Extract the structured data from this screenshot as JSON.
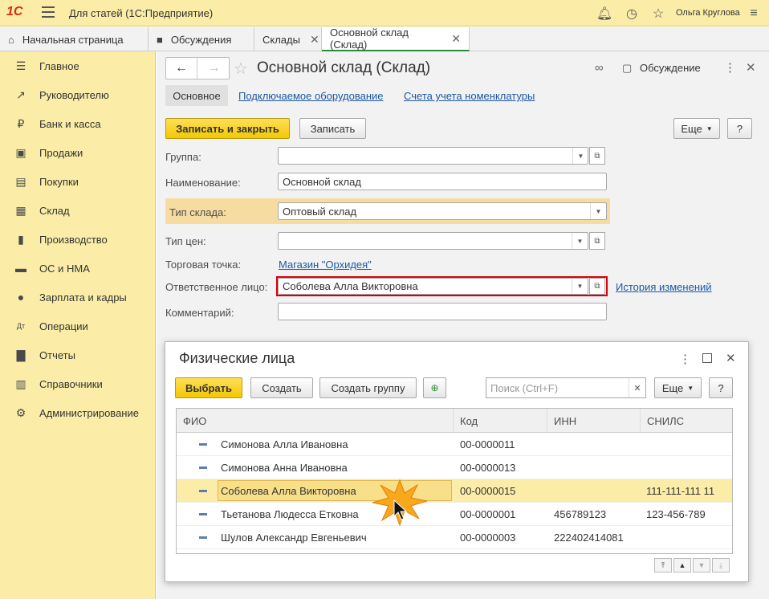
{
  "titlebar": {
    "logo": "1С",
    "title": "Для статей  (1С:Предприятие)",
    "user": "Ольга Круглова"
  },
  "tabs": [
    {
      "label": "Начальная страница"
    },
    {
      "label": "Обсуждения"
    },
    {
      "label": "Склады"
    },
    {
      "label": "Основной склад (Склад)"
    }
  ],
  "sidebar": {
    "items": [
      {
        "label": "Главное",
        "icon": "menu-lines-icon"
      },
      {
        "label": "Руководителю",
        "icon": "trend-chart-icon"
      },
      {
        "label": "Банк и касса",
        "icon": "ruble-coin-icon"
      },
      {
        "label": "Продажи",
        "icon": "shopping-bag-icon"
      },
      {
        "label": "Покупки",
        "icon": "shopping-cart-icon"
      },
      {
        "label": "Склад",
        "icon": "warehouse-grid-icon"
      },
      {
        "label": "Производство",
        "icon": "factory-icon"
      },
      {
        "label": "ОС и НМА",
        "icon": "truck-icon"
      },
      {
        "label": "Зарплата и кадры",
        "icon": "person-icon"
      },
      {
        "label": "Операции",
        "icon": "dt-kt-icon"
      },
      {
        "label": "Отчеты",
        "icon": "bar-chart-icon"
      },
      {
        "label": "Справочники",
        "icon": "books-icon"
      },
      {
        "label": "Администрирование",
        "icon": "gear-icon"
      }
    ]
  },
  "form": {
    "title": "Основной склад (Склад)",
    "discussion": "Обсуждение",
    "subtabs": [
      "Основное",
      "Подключаемое оборудование",
      "Счета учета номенклатуры"
    ],
    "save_close": "Записать и закрыть",
    "save": "Записать",
    "more": "Еще",
    "help": "?",
    "fields": {
      "group": {
        "label": "Группа:",
        "value": ""
      },
      "name": {
        "label": "Наименование:",
        "value": "Основной склад"
      },
      "type": {
        "label": "Тип склада:",
        "value": "Оптовый склад"
      },
      "price_type": {
        "label": "Тип цен:",
        "value": ""
      },
      "store": {
        "label": "Торговая точка:",
        "value": "Магазин \"Орхидея\""
      },
      "responsible": {
        "label": "Ответственное лицо:",
        "value": "Соболева Алла Викторовна"
      },
      "comment": {
        "label": "Комментарий:",
        "value": ""
      }
    },
    "history_link": "История изменений"
  },
  "dialog": {
    "title": "Физические лица",
    "select": "Выбрать",
    "create": "Создать",
    "create_group": "Создать группу",
    "search_placeholder": "Поиск (Ctrl+F)",
    "more": "Еще",
    "help": "?",
    "columns": [
      "ФИО",
      "Код",
      "ИНН",
      "СНИЛС"
    ],
    "rows": [
      {
        "name": "Симонова Алла Ивановна",
        "code": "00-0000011",
        "inn": "",
        "snils": ""
      },
      {
        "name": "Симонова Анна Ивановна",
        "code": "00-0000013",
        "inn": "",
        "snils": ""
      },
      {
        "name": "Соболева Алла Викторовна",
        "code": "00-0000015",
        "inn": "",
        "snils": "111-111-111 11"
      },
      {
        "name": "Тьетанова Людесса Етковна",
        "code": "00-0000001",
        "inn": "456789123",
        "snils": "123-456-789"
      },
      {
        "name": "Шулов Александр Евгеньевич",
        "code": "00-0000003",
        "inn": "222402414081",
        "snils": ""
      }
    ],
    "selected_row": 2
  },
  "colors": {
    "accent_yellow": "#f4c800",
    "sidebar_bg": "#fbeda7",
    "link": "#1d58a3",
    "error_border": "#d9000d"
  }
}
